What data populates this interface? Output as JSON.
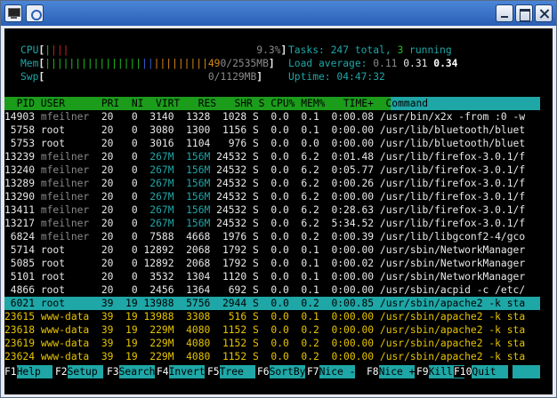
{
  "window": {
    "app_icon": "terminal-icon",
    "menu_icon": "window-menu-icon"
  },
  "meters": {
    "cpu": {
      "label": "CPU",
      "value": "9.3%"
    },
    "mem": {
      "label": "Mem",
      "value_prefix": "49",
      "value_rest": "0/2535MB"
    },
    "swp": {
      "label": "Swp",
      "value": "0/1129MB"
    }
  },
  "summary": {
    "tasks_label": "Tasks: ",
    "tasks_total": "247",
    "tasks_total_suffix": " total, ",
    "tasks_running": "3",
    "tasks_running_suffix": " running",
    "load_label": "Load average: ",
    "load_1": "0.11",
    "load_5": "0.31",
    "load_15": "0.34",
    "uptime_label": "Uptime: ",
    "uptime": "04:47:32"
  },
  "columns": {
    "left": "  PID USER      PRI  NI  VIRT   RES   SHR S CPU% MEM%   TIME+  ",
    "sorted": "Command"
  },
  "processes": [
    {
      "pid": "14903",
      "user": "mfeilner",
      "pri": "20",
      "ni": "0",
      "virt": "3140",
      "res": "1328",
      "shr": "1028",
      "s": "S",
      "cpu": "0.0",
      "mem": "0.1",
      "time": "0:00.08",
      "cmd": "/usr/bin/x2x -from :0 -w"
    },
    {
      "pid": "5758",
      "user": "root",
      "pri": "20",
      "ni": "0",
      "virt": "3080",
      "res": "1300",
      "shr": "1156",
      "s": "S",
      "cpu": "0.0",
      "mem": "0.1",
      "time": "0:00.00",
      "cmd": "/usr/lib/bluetooth/bluet"
    },
    {
      "pid": "5753",
      "user": "root",
      "pri": "20",
      "ni": "0",
      "virt": "3016",
      "res": "1104",
      "shr": "976",
      "s": "S",
      "cpu": "0.0",
      "mem": "0.0",
      "time": "0:00.00",
      "cmd": "/usr/lib/bluetooth/bluet"
    },
    {
      "pid": "13239",
      "user": "mfeilner",
      "pri": "20",
      "ni": "0",
      "virt": "267M",
      "res": "156M",
      "shr": "24532",
      "s": "S",
      "cpu": "0.0",
      "mem": "6.2",
      "time": "0:01.48",
      "cmd": "/usr/lib/firefox-3.0.1/f"
    },
    {
      "pid": "13240",
      "user": "mfeilner",
      "pri": "20",
      "ni": "0",
      "virt": "267M",
      "res": "156M",
      "shr": "24532",
      "s": "S",
      "cpu": "0.0",
      "mem": "6.2",
      "time": "0:05.77",
      "cmd": "/usr/lib/firefox-3.0.1/f"
    },
    {
      "pid": "13289",
      "user": "mfeilner",
      "pri": "20",
      "ni": "0",
      "virt": "267M",
      "res": "156M",
      "shr": "24532",
      "s": "S",
      "cpu": "0.0",
      "mem": "6.2",
      "time": "0:00.26",
      "cmd": "/usr/lib/firefox-3.0.1/f"
    },
    {
      "pid": "13290",
      "user": "mfeilner",
      "pri": "20",
      "ni": "0",
      "virt": "267M",
      "res": "156M",
      "shr": "24532",
      "s": "S",
      "cpu": "0.0",
      "mem": "6.2",
      "time": "0:00.00",
      "cmd": "/usr/lib/firefox-3.0.1/f"
    },
    {
      "pid": "13411",
      "user": "mfeilner",
      "pri": "20",
      "ni": "0",
      "virt": "267M",
      "res": "156M",
      "shr": "24532",
      "s": "S",
      "cpu": "0.0",
      "mem": "6.2",
      "time": "0:28.63",
      "cmd": "/usr/lib/firefox-3.0.1/f"
    },
    {
      "pid": "13217",
      "user": "mfeilner",
      "pri": "20",
      "ni": "0",
      "virt": "267M",
      "res": "156M",
      "shr": "24532",
      "s": "S",
      "cpu": "0.0",
      "mem": "6.2",
      "time": "5:34.52",
      "cmd": "/usr/lib/firefox-3.0.1/f"
    },
    {
      "pid": "6824",
      "user": "mfeilner",
      "pri": "20",
      "ni": "0",
      "virt": "7588",
      "res": "4668",
      "shr": "1976",
      "s": "S",
      "cpu": "0.0",
      "mem": "0.2",
      "time": "0:00.39",
      "cmd": "/usr/lib/libgconf2-4/gco"
    },
    {
      "pid": "5714",
      "user": "root",
      "pri": "20",
      "ni": "0",
      "virt": "12892",
      "res": "2068",
      "shr": "1792",
      "s": "S",
      "cpu": "0.0",
      "mem": "0.1",
      "time": "0:00.00",
      "cmd": "/usr/sbin/NetworkManager"
    },
    {
      "pid": "5085",
      "user": "root",
      "pri": "20",
      "ni": "0",
      "virt": "12892",
      "res": "2068",
      "shr": "1792",
      "s": "S",
      "cpu": "0.0",
      "mem": "0.1",
      "time": "0:00.02",
      "cmd": "/usr/sbin/NetworkManager"
    },
    {
      "pid": "5101",
      "user": "root",
      "pri": "20",
      "ni": "0",
      "virt": "3532",
      "res": "1304",
      "shr": "1120",
      "s": "S",
      "cpu": "0.0",
      "mem": "0.1",
      "time": "0:00.00",
      "cmd": "/usr/sbin/NetworkManager"
    },
    {
      "pid": "4866",
      "user": "root",
      "pri": "20",
      "ni": "0",
      "virt": "2456",
      "res": "1364",
      "shr": "692",
      "s": "S",
      "cpu": "0.0",
      "mem": "0.1",
      "time": "0:00.00",
      "cmd": "/usr/sbin/acpid -c /etc/"
    },
    {
      "pid": "6021",
      "user": "root",
      "pri": "39",
      "ni": "19",
      "virt": "13988",
      "res": "5756",
      "shr": "2944",
      "s": "S",
      "cpu": "0.0",
      "mem": "0.2",
      "time": "0:00.85",
      "cmd": "/usr/sbin/apache2 -k sta"
    },
    {
      "pid": "23615",
      "user": "www-data",
      "pri": "39",
      "ni": "19",
      "virt": "13988",
      "res": "3308",
      "shr": "516",
      "s": "S",
      "cpu": "0.0",
      "mem": "0.1",
      "time": "0:00.00",
      "cmd": "/usr/sbin/apache2 -k sta"
    },
    {
      "pid": "23618",
      "user": "www-data",
      "pri": "39",
      "ni": "19",
      "virt": "229M",
      "res": "4080",
      "shr": "1152",
      "s": "S",
      "cpu": "0.0",
      "mem": "0.2",
      "time": "0:00.00",
      "cmd": "/usr/sbin/apache2 -k sta"
    },
    {
      "pid": "23619",
      "user": "www-data",
      "pri": "39",
      "ni": "19",
      "virt": "229M",
      "res": "4080",
      "shr": "1152",
      "s": "S",
      "cpu": "0.0",
      "mem": "0.2",
      "time": "0:00.00",
      "cmd": "/usr/sbin/apache2 -k sta"
    },
    {
      "pid": "23624",
      "user": "www-data",
      "pri": "39",
      "ni": "19",
      "virt": "229M",
      "res": "4080",
      "shr": "1152",
      "s": "S",
      "cpu": "0.0",
      "mem": "0.2",
      "time": "0:00.00",
      "cmd": "/usr/sbin/apache2 -k sta"
    }
  ],
  "selected_row": 14,
  "highlight_rows": [
    15,
    16,
    17,
    18
  ],
  "function_keys": [
    {
      "key": "F1",
      "label": "Help  "
    },
    {
      "key": "F2",
      "label": "Setup "
    },
    {
      "key": "F3",
      "label": "Search"
    },
    {
      "key": "F4",
      "label": "Invert"
    },
    {
      "key": "F5",
      "label": "Tree  "
    },
    {
      "key": "F6",
      "label": "SortBy"
    },
    {
      "key": "F7",
      "label": "Nice -"
    },
    {
      "key": "F8",
      "label": "Nice +"
    },
    {
      "key": "F9",
      "label": "Kill  "
    },
    {
      "key": "F10",
      "label": "Quit  "
    }
  ],
  "colors": {
    "terminal_bg": "#000000",
    "header_bar": "#1b9c1b",
    "sort_column": "#1fa6a6",
    "selected_row": "#1fa6a6",
    "niced_text": "#e6c400",
    "titlebar": "#2a5fb4"
  }
}
